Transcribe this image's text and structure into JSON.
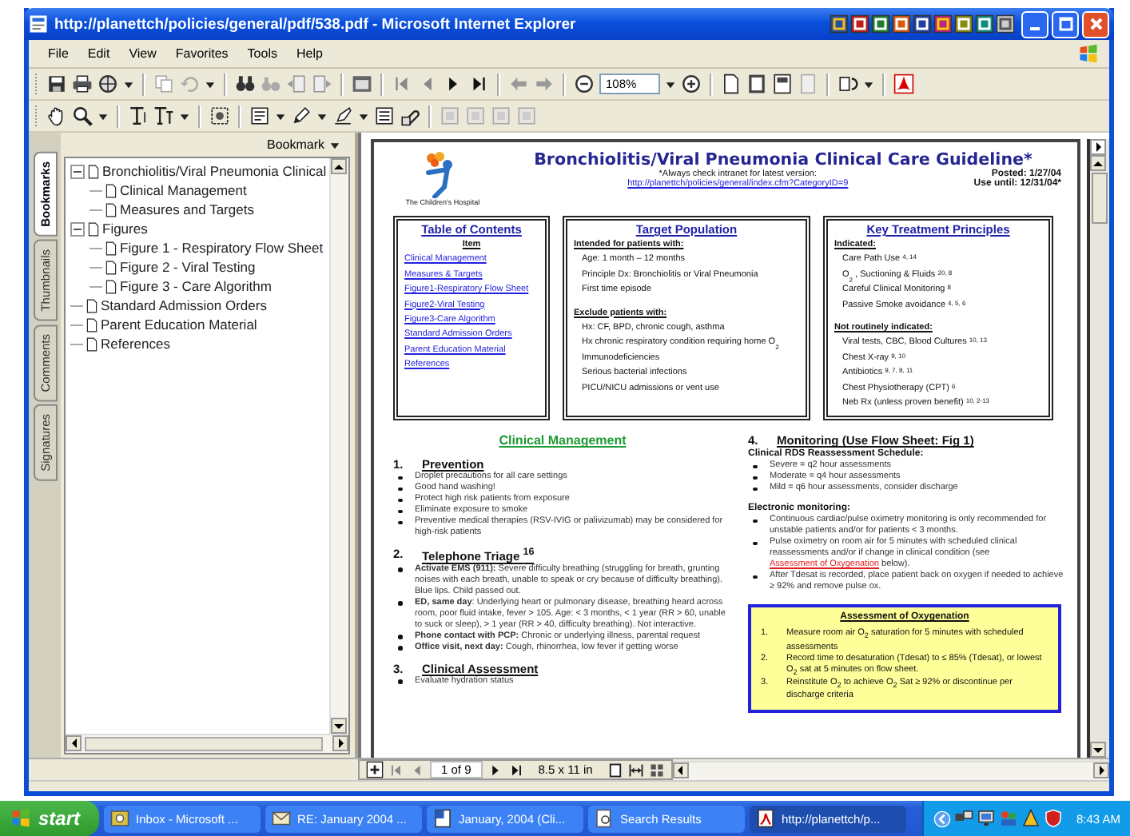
{
  "window": {
    "title": "http://planettch/policies/general/pdf/538.pdf - Microsoft Internet Explorer"
  },
  "menu": [
    "File",
    "Edit",
    "View",
    "Favorites",
    "Tools",
    "Help"
  ],
  "toolbar": {
    "zoom": "108%"
  },
  "side_tabs": [
    {
      "label": "Bookmarks",
      "selected": true
    },
    {
      "label": "Thumbnails",
      "selected": false
    },
    {
      "label": "Comments",
      "selected": false
    },
    {
      "label": "Signatures",
      "selected": false
    }
  ],
  "bookmarks": {
    "header": "Bookmark",
    "tree": [
      {
        "label": "Bronchiolitis/Viral Pneumonia Clinical",
        "expanded": true,
        "children": [
          {
            "label": "Clinical Management"
          },
          {
            "label": "Measures and Targets"
          }
        ]
      },
      {
        "label": "Figures",
        "expanded": true,
        "children": [
          {
            "label": "Figure 1 - Respiratory Flow Sheet"
          },
          {
            "label": "Figure 2 - Viral Testing"
          },
          {
            "label": "Figure 3 - Care Algorithm"
          }
        ]
      },
      {
        "label": "Standard Admission Orders"
      },
      {
        "label": "Parent Education Material"
      },
      {
        "label": "References"
      }
    ]
  },
  "document": {
    "logo_caption": "The Children's Hospital",
    "title": "Bronchiolitis/Viral Pneumonia Clinical Care Guideline*",
    "note": "*Always check intranet for latest version:",
    "link": "http://planettch/policies/general/index.cfm?CategoryID=9",
    "posted": "Posted: 1/27/04",
    "use_until": "Use until:  12/31/04*",
    "toc": {
      "title": "Table of Contents",
      "heading": "Item",
      "items": [
        "Clinical Management",
        "Measures & Targets",
        "Figure1-Respiratory Flow Sheet",
        "Figure2-Viral Testing",
        "Figure3-Care Algorithm",
        "Standard Admission Orders",
        "Parent Education Material",
        "References"
      ]
    },
    "target": {
      "title": "Target Population",
      "groups": [
        {
          "heading": "Intended for patients with:",
          "items": [
            "Age: 1 month – 12 months",
            "Principle Dx: Bronchiolitis or Viral Pneumonia",
            "First time episode"
          ]
        },
        {
          "heading": "Exclude patients with:",
          "items": [
            "Hx: CF, BPD, chronic cough, asthma",
            "Hx chronic respiratory condition requiring home O$_{2}$",
            "Immunodeficiencies",
            "Serious bacterial infections",
            "PICU/NICU admissions or vent use"
          ]
        }
      ]
    },
    "principles": {
      "title": "Key Treatment Principles",
      "groups": [
        {
          "heading": "Indicated:",
          "items": [
            "Care Path Use $^{4, 14}$",
            "O$_{2}$ , Suctioning & Fluids $^{20, 8}$",
            "Careful Clinical Monitoring $^{8}$",
            "Passive Smoke avoidance $^{4, 5, 6}$"
          ]
        },
        {
          "heading": "Not routinely indicated:",
          "items": [
            "Viral tests, CBC, Blood Cultures $^{10, 13}$",
            "Chest X-ray $^{9, 10}$",
            "Antibiotics $^{9, 7, 8, 11}$",
            "Chest Physiotherapy (CPT) $^{6}$",
            "Neb Rx (unless proven benefit) $^{10, 2-13}$"
          ]
        }
      ]
    },
    "management": {
      "title": "Clinical Management",
      "sections": [
        {
          "number": "1.",
          "title": "Prevention",
          "bullets": [
            "Droplet precautions for all care settings",
            "Good hand washing!",
            "Protect high risk patients from exposure",
            "Eliminate exposure to smoke",
            "Preventive medical therapies (RSV-IVIG or palivizumab) may be considered for high-risk patients"
          ]
        },
        {
          "number": "2.",
          "title": "Telephone Triage $^{16}$",
          "bullets": [
            "**Activate EMS (911):** Severe difficulty breathing (struggling for breath, grunting noises with each breath, unable to speak or cry because of difficulty breathing). Blue lips. Child passed out.",
            "**ED, same day**: Underlying heart or pulmonary disease, breathing heard across room, poor fluid intake, fever > 105. Age: < 3 months, < 1 year (RR > 60, unable to suck or sleep), > 1 year (RR > 40, difficulty breathing). Not interactive.",
            "**Phone contact with PCP:** Chronic or underlying illness, parental request",
            "**Office visit, next day:**  Cough, rhinorrhea, low fever if getting worse"
          ]
        },
        {
          "number": "3.",
          "title": "Clinical Assessment",
          "bullets": [
            "Evaluate hydration status"
          ]
        }
      ]
    },
    "monitoring": {
      "number": "4.",
      "title": "Monitoring (Use Flow Sheet: Fig 1)",
      "groups": [
        {
          "heading": "Clinical RDS Reassessment Schedule:",
          "bullets": [
            {
              "text": "Severe = q2 hour assessments"
            },
            {
              "text": "Moderate = q4 hour assessments"
            },
            {
              "text": "Mild = q6 hour assessments, consider discharge"
            }
          ]
        },
        {
          "heading": "Electronic monitoring:",
          "bullets": [
            {
              "text": "Continuous cardiac/pulse oximetry monitoring is only recommended for unstable patients and/or for patients < 3 months."
            },
            {
              "text": "Pulse oximetry on room air for 5 minutes with scheduled clinical reassessments and/or if change in clinical condition (see ",
              "link": "Assessment of Oxygenation",
              "after": " below)."
            },
            {
              "text": "After Tdesat is recorded, place patient back on oxygen if needed to achieve ≥ 92% and remove pulse ox."
            }
          ]
        }
      ]
    },
    "oxygen": {
      "title": "Assessment of Oxygenation",
      "steps": [
        {
          "number": "1.",
          "text": "Measure room air O$_{2}$ saturation for 5 minutes with scheduled assessments"
        },
        {
          "number": "2.",
          "text": "Record time to desaturation (Tdesat) to ≤ 85% (Tdesat), or lowest O$_{2}$ sat at 5 minutes on flow sheet."
        },
        {
          "number": "3.",
          "text": "Reinstitute O$_{2}$ to achieve O$_{2}$ Sat ≥ 92% or discontinue per discharge criteria"
        }
      ]
    }
  },
  "page_nav": {
    "page": "1 of 9",
    "size": "8.5 x 11 in"
  },
  "taskbar": {
    "start": "start",
    "tasks": [
      {
        "label": "Inbox - Microsoft ...",
        "selected": false
      },
      {
        "label": "RE: January 2004 ...",
        "selected": false
      },
      {
        "label": "January, 2004 (Cli...",
        "selected": false
      },
      {
        "label": "Search Results",
        "selected": false
      },
      {
        "label": "http://planettch/p...",
        "selected": true
      }
    ],
    "clock": "8:43 AM"
  }
}
